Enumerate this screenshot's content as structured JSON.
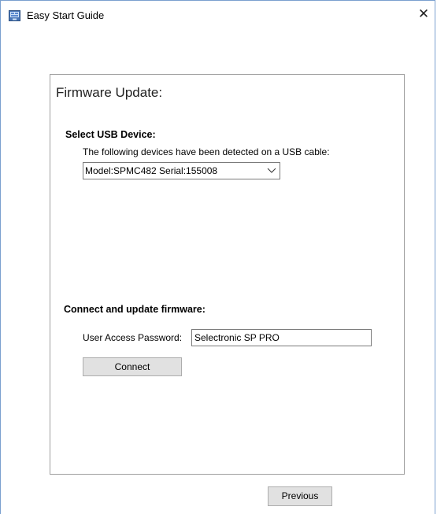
{
  "window": {
    "title": "Easy Start Guide",
    "close_glyph": "✕"
  },
  "panel": {
    "title": "Firmware Update:",
    "select_section": {
      "heading": "Select USB Device:",
      "description": "The following devices have been detected on a USB cable:",
      "selected_device": "Model:SPMC482 Serial:155008"
    },
    "connect_section": {
      "heading": "Connect and update firmware:",
      "password_label": "User Access Password:",
      "password_value": "Selectronic SP PRO",
      "connect_label": "Connect"
    }
  },
  "footer": {
    "previous_label": "Previous"
  },
  "icons": {
    "app": "app-window-icon",
    "close": "close-icon",
    "dropdown": "chevron-down-icon"
  },
  "colors": {
    "window_border": "#7aa0cf",
    "button_bg": "#e1e1e1",
    "panel_border": "#a0a0a0"
  }
}
